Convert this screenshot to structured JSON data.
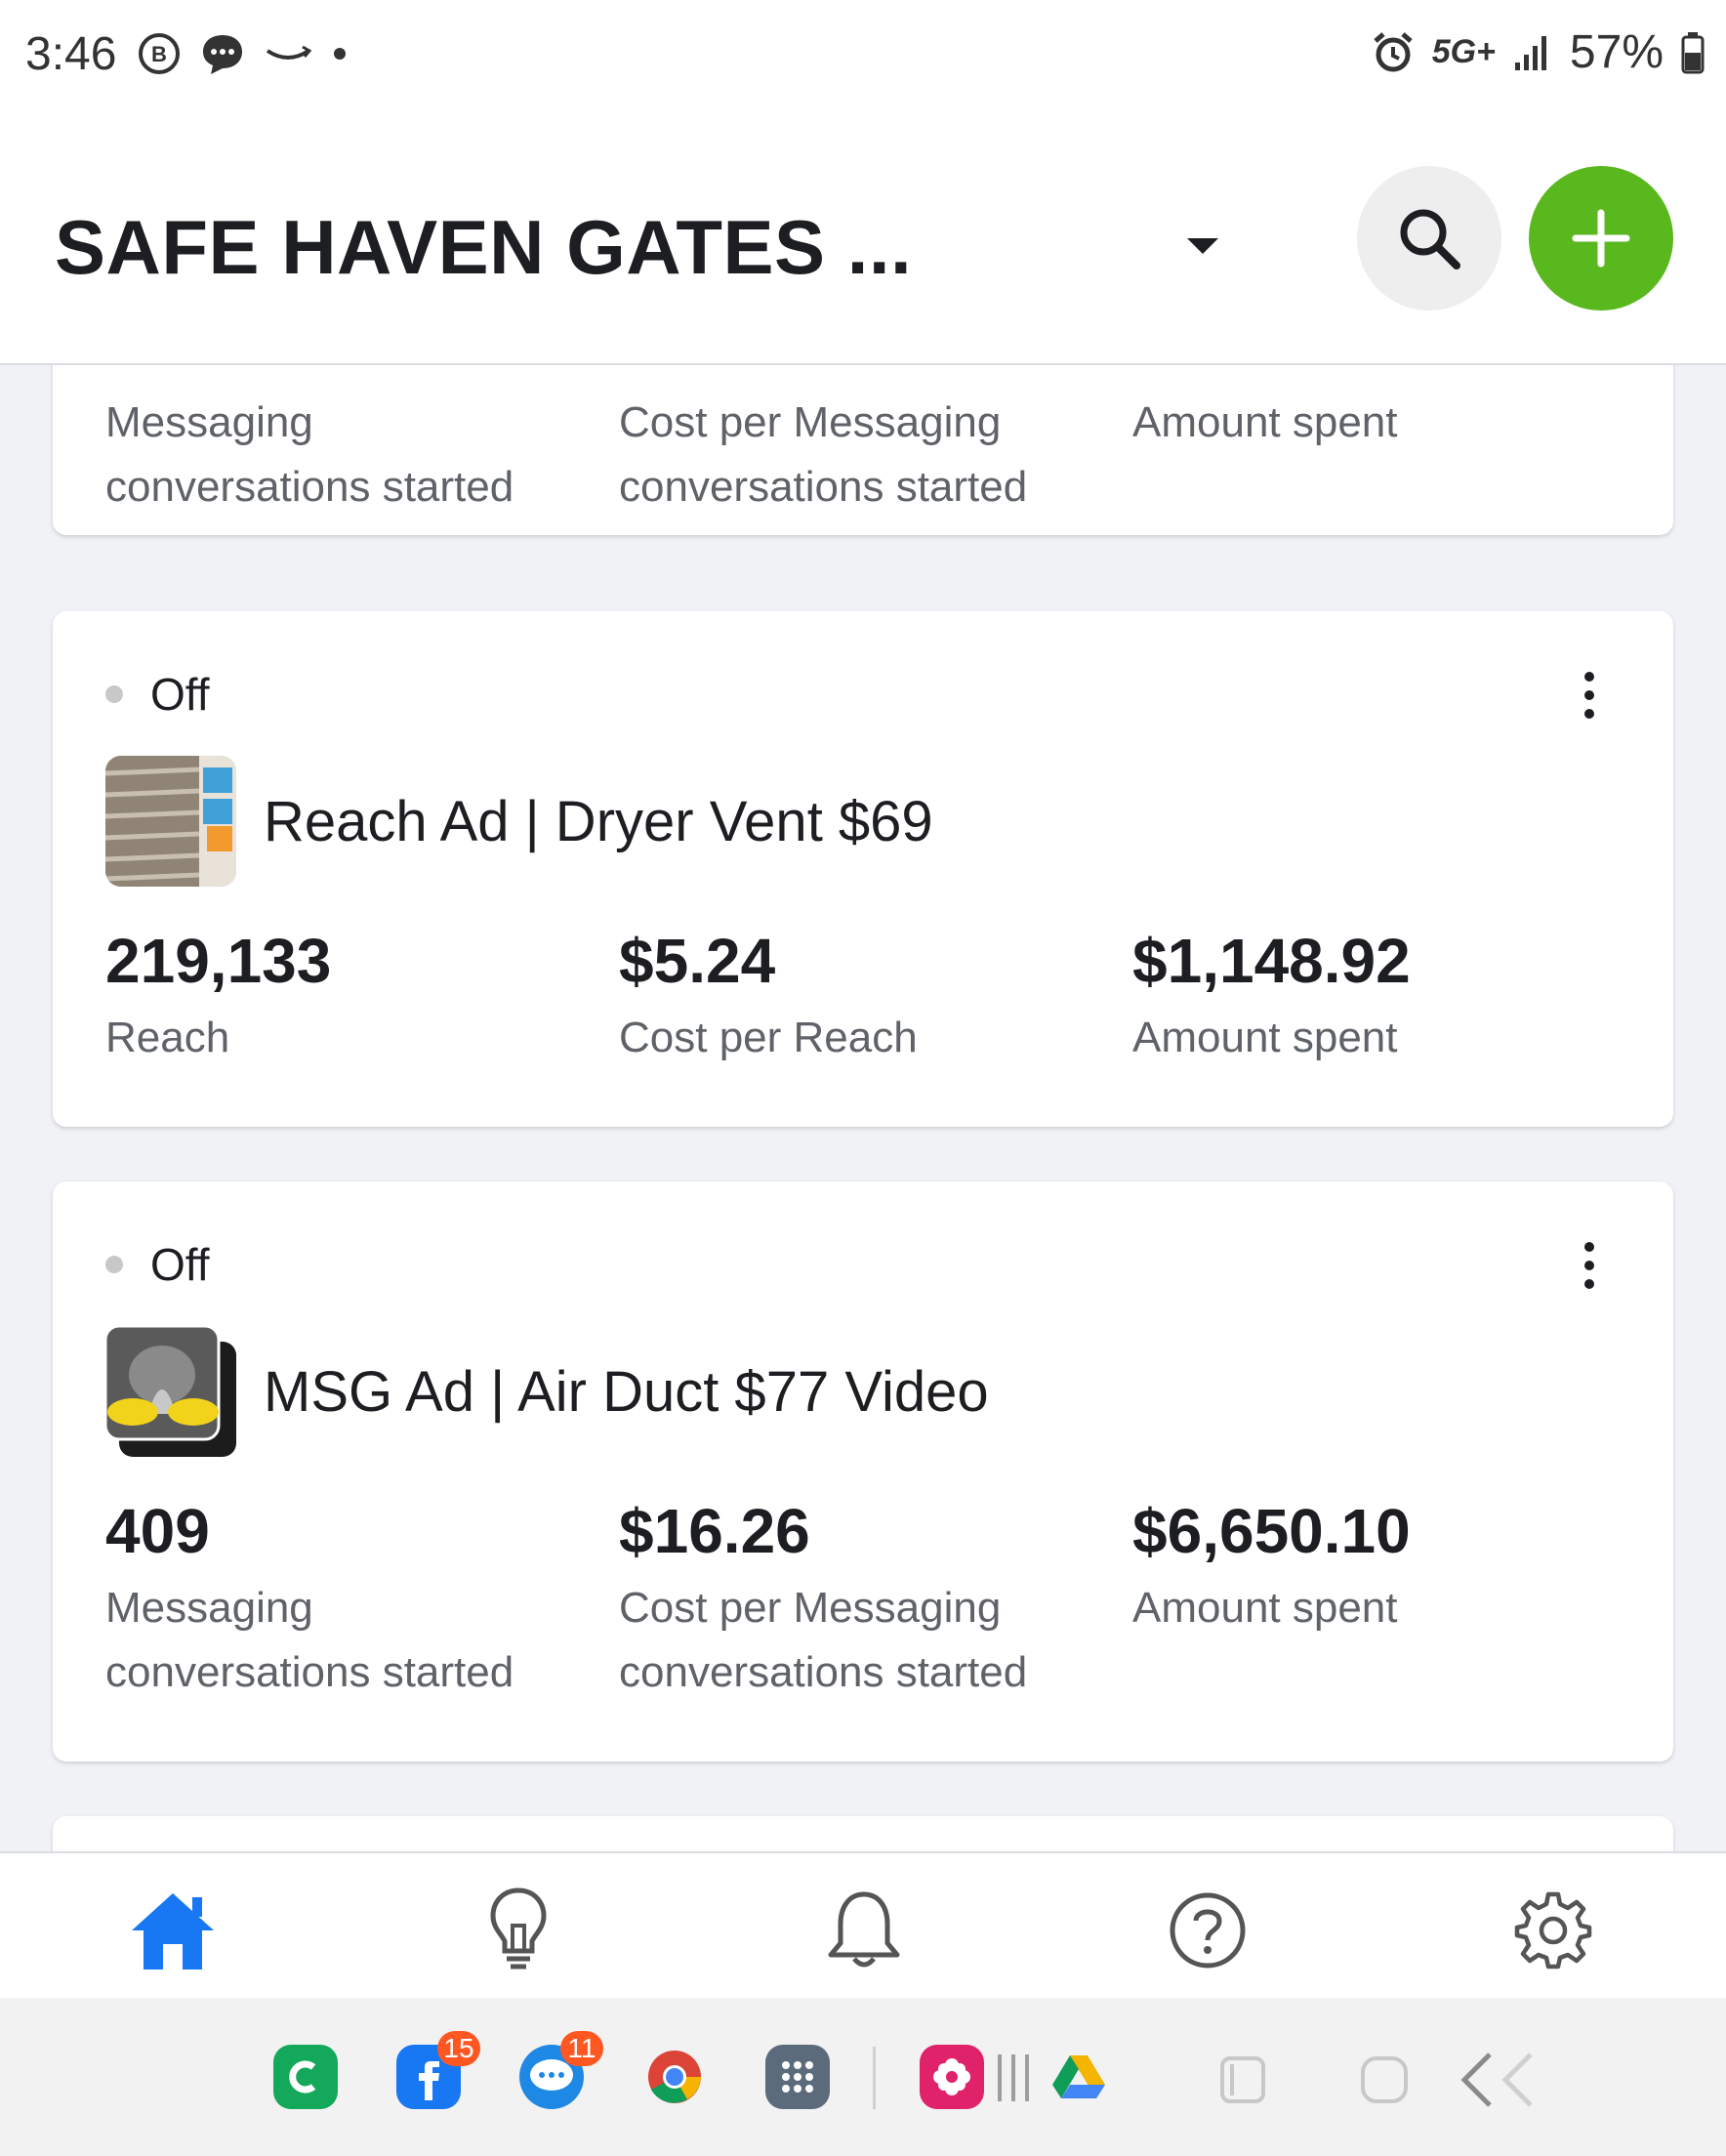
{
  "status_bar": {
    "time": "3:46",
    "network": "5G+",
    "battery": "57%"
  },
  "header": {
    "title": "SAFE HAVEN GATES ...",
    "search_icon": "search-icon",
    "add_icon": "plus-icon",
    "accent_color": "#5ab81f"
  },
  "cards": [
    {
      "metrics": [
        {
          "label_1": "Messaging",
          "label_2": "conversations started"
        },
        {
          "label_1": "Cost per Messaging",
          "label_2": "conversations started"
        },
        {
          "label_1": "Amount spent"
        }
      ]
    },
    {
      "status": "Off",
      "ad_name": "Reach Ad | Dryer Vent $69",
      "metrics": [
        {
          "value": "219,133",
          "label_1": "Reach"
        },
        {
          "value": "$5.24",
          "label_1": "Cost per Reach"
        },
        {
          "value": "$1,148.92",
          "label_1": "Amount spent"
        }
      ]
    },
    {
      "status": "Off",
      "ad_name": "MSG Ad | Air Duct $77 Video",
      "metrics": [
        {
          "value": "409",
          "label_1": "Messaging",
          "label_2": "conversations started"
        },
        {
          "value": "$16.26",
          "label_1": "Cost per Messaging",
          "label_2": "conversations started"
        },
        {
          "value": "$6,650.10",
          "label_1": "Amount spent"
        }
      ]
    }
  ],
  "bottom_nav": {
    "items": [
      "home-icon",
      "lightbulb-icon",
      "bell-icon",
      "help-icon",
      "gear-icon"
    ],
    "active_color": "#1877f2"
  },
  "taskbar": {
    "badges": {
      "facebook": "15",
      "messages": "11"
    }
  }
}
